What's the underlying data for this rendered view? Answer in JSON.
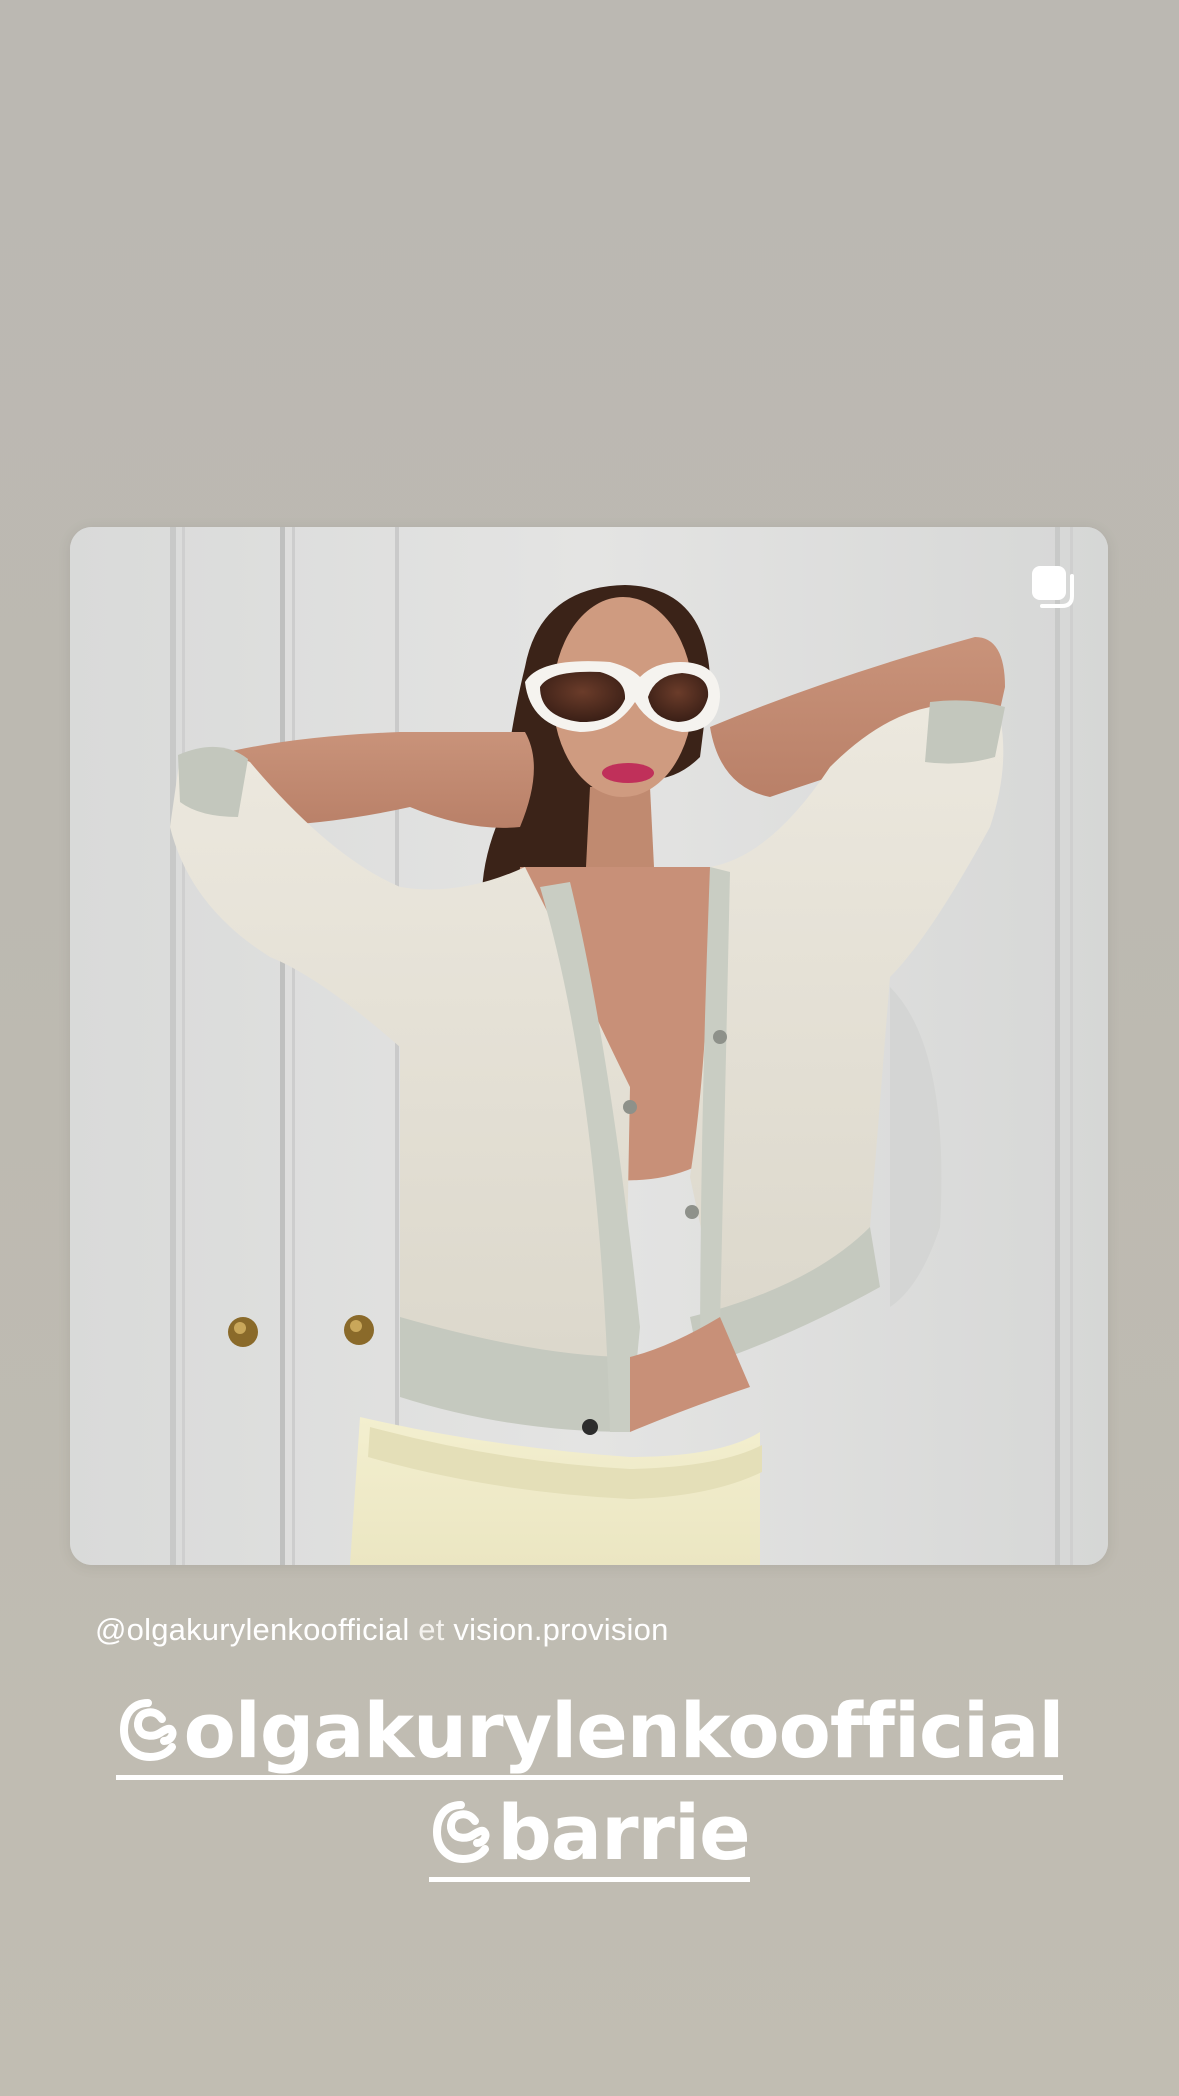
{
  "story": {
    "post": {
      "image_alt": "Woman in white sunglasses, cream knit cardigan and pale yellow skirt posing with hands behind head in front of white doors",
      "multi_image_icon": "carousel-icon"
    },
    "caption": {
      "user1": "@olgakurylenkoofficial",
      "connector": "et",
      "user2": "vision.provision"
    },
    "mentions": [
      {
        "handle": "olgakurylenkoofficial",
        "icon": "threads-at-icon"
      },
      {
        "handle": "barrie",
        "icon": "threads-at-icon"
      }
    ]
  },
  "colors": {
    "background_top": "#bbb8b2",
    "background_bottom": "#c1bdb2",
    "text": "#ffffff"
  }
}
